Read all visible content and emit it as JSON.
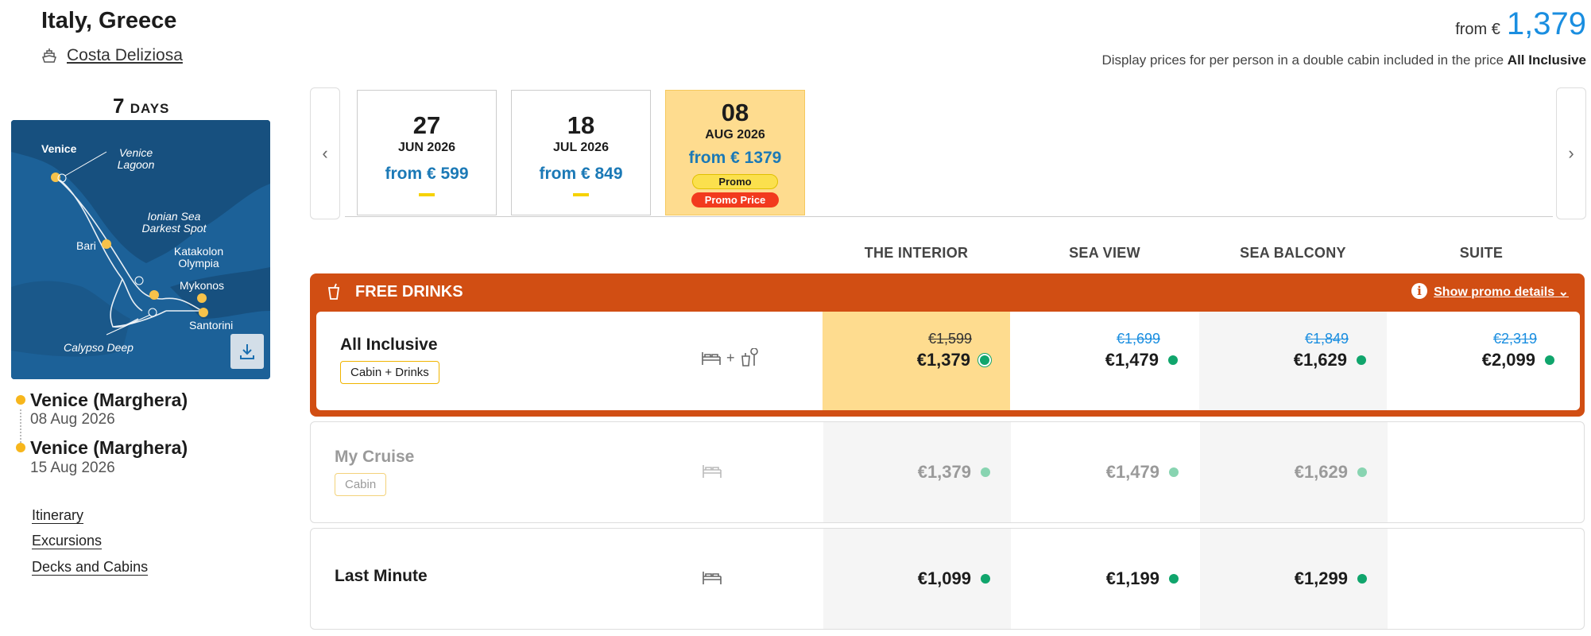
{
  "header": {
    "title": "Italy, Greece",
    "ship": "Costa Deliziosa",
    "price_from_label": "from €",
    "price_from_value": "1,379",
    "disclaimer_text": "Display prices for per person in a double cabin included in the price",
    "disclaimer_bold": "All Inclusive"
  },
  "trip": {
    "days_number": "7",
    "days_label": "DAYS",
    "map_labels": [
      "Venice",
      "Venice Lagoon",
      "Ionian Sea Darkest Spot",
      "Bari",
      "Katakolon Olympia",
      "Mykonos",
      "Santorini",
      "Calypso Deep"
    ],
    "departure": {
      "port": "Venice (Marghera)",
      "date": "08 Aug 2026"
    },
    "arrival": {
      "port": "Venice (Marghera)",
      "date": "15 Aug 2026"
    },
    "links": [
      "Itinerary",
      "Excursions",
      "Decks and Cabins"
    ]
  },
  "dates": [
    {
      "day": "27",
      "month": "JUN 2026",
      "from": "from € 599"
    },
    {
      "day": "18",
      "month": "JUL 2026",
      "from": "from € 849"
    },
    {
      "day": "08",
      "month": "AUG 2026",
      "from": "from € 1379",
      "badge1": "Promo",
      "badge2": "Promo Price",
      "selected": true
    }
  ],
  "columns": [
    "THE INTERIOR",
    "SEA VIEW",
    "SEA BALCONY",
    "SUITE"
  ],
  "promo": {
    "title": "FREE DRINKS",
    "link": "Show promo details"
  },
  "rates": [
    {
      "name": "All Inclusive",
      "badge": "Cabin + Drinks",
      "icon_sep": "+",
      "old_prices": [
        "€1,599",
        "€1,699",
        "€1,849",
        "€2,319"
      ],
      "prices": [
        "€1,379",
        "€1,479",
        "€1,629",
        "€2,099"
      ]
    },
    {
      "name": "My Cruise",
      "badge": "Cabin",
      "prices": [
        "€1,379",
        "€1,479",
        "€1,629"
      ]
    },
    {
      "name": "Last Minute",
      "prices": [
        "€1,099",
        "€1,199",
        "€1,299"
      ]
    }
  ],
  "colors": {
    "accent_blue": "#1a8ee0",
    "promo_orange": "#d14e13",
    "selected_yellow": "#fedc8f",
    "available_green": "#10a56c"
  }
}
